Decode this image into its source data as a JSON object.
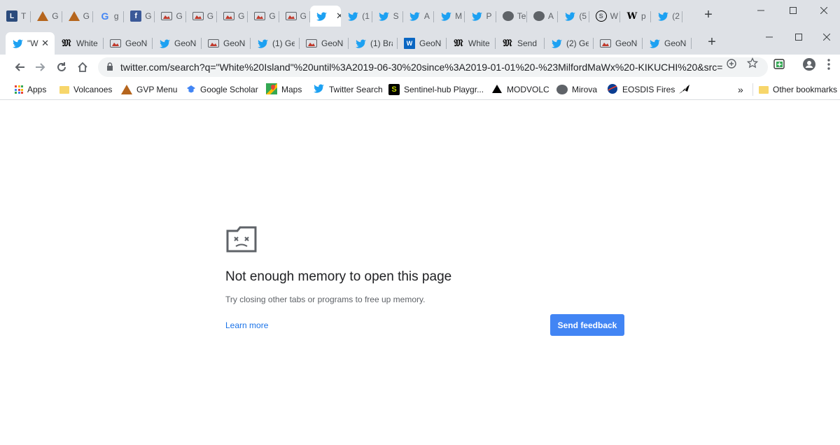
{
  "outer_window": {
    "tabs": [
      {
        "icon": "tweetdeck-icon",
        "label": "T"
      },
      {
        "icon": "volcano-icon",
        "label": "G"
      },
      {
        "icon": "volcano-icon",
        "label": "G"
      },
      {
        "icon": "google-icon",
        "label": "g"
      },
      {
        "icon": "facebook-icon",
        "label": "G"
      },
      {
        "icon": "geonet-icon",
        "label": "G"
      },
      {
        "icon": "geonet-icon",
        "label": "G"
      },
      {
        "icon": "geonet-icon",
        "label": "G"
      },
      {
        "icon": "geonet-icon",
        "label": "G"
      },
      {
        "icon": "geonet-icon",
        "label": "G"
      },
      {
        "icon": "twitter-icon",
        "label": "",
        "active": true
      },
      {
        "icon": "twitter-icon",
        "label": "(1"
      },
      {
        "icon": "twitter-icon",
        "label": "S"
      },
      {
        "icon": "twitter-icon",
        "label": "A"
      },
      {
        "icon": "twitter-icon",
        "label": "M"
      },
      {
        "icon": "twitter-icon",
        "label": "P"
      },
      {
        "icon": "globe-icon",
        "label": "Te"
      },
      {
        "icon": "globe-icon",
        "label": "A"
      },
      {
        "icon": "twitter-icon",
        "label": "(5"
      },
      {
        "icon": "sentinel-icon",
        "label": "W"
      },
      {
        "icon": "wordpress-icon",
        "label": "p"
      },
      {
        "icon": "twitter-icon",
        "label": "(2"
      }
    ],
    "new_tab": "+"
  },
  "inner_window": {
    "tabs": [
      {
        "icon": "twitter-icon",
        "label": "\"W",
        "active": true
      },
      {
        "icon": "nyt-icon",
        "label": "White"
      },
      {
        "icon": "geonet-icon",
        "label": "GeoNe"
      },
      {
        "icon": "twitter-icon",
        "label": "GeoNe"
      },
      {
        "icon": "geonet-icon",
        "label": "GeoNe"
      },
      {
        "icon": "twitter-icon",
        "label": "(1) Ge"
      },
      {
        "icon": "geonet-icon",
        "label": "GeoNe"
      },
      {
        "icon": "twitter-icon",
        "label": "(1) Bra"
      },
      {
        "icon": "w-icon",
        "label": "GeoNe"
      },
      {
        "icon": "nyt-icon",
        "label": "White"
      },
      {
        "icon": "nyt-icon",
        "label": "Send"
      },
      {
        "icon": "twitter-icon",
        "label": "(2) Ge"
      },
      {
        "icon": "geonet-icon",
        "label": "GeoNe"
      },
      {
        "icon": "twitter-icon",
        "label": "GeoNe"
      }
    ],
    "new_tab": "+"
  },
  "toolbar": {
    "url": "twitter.com/search?q=\"White%20Island\"%20until%3A2019-06-30%20since%3A2019-01-01%20-%23MilfordMaWx%20-KIKUCHI%20&src=type..."
  },
  "bookmarks": [
    {
      "label": "Apps",
      "icon": "apps-icon"
    },
    {
      "label": "Volcanoes",
      "icon": "folder-icon"
    },
    {
      "label": "GVP Menu",
      "icon": "volcano-icon"
    },
    {
      "label": "Google Scholar",
      "icon": "scholar-icon"
    },
    {
      "label": "Maps",
      "icon": "maps-icon"
    },
    {
      "label": "Twitter Search",
      "icon": "twitter-icon"
    },
    {
      "label": "Sentinel-hub Playgr...",
      "icon": "sentinel-icon"
    },
    {
      "label": "MODVOLC",
      "icon": "modvolc-icon"
    },
    {
      "label": "Mirova",
      "icon": "globe-icon"
    },
    {
      "label": "EOSDIS Fires",
      "icon": "nasa-icon"
    },
    {
      "label": "",
      "icon": "bird-icon"
    }
  ],
  "bookmarks_overflow": "»",
  "other_bookmarks": "Other bookmarks",
  "error": {
    "title": "Not enough memory to open this page",
    "description": "Try closing other tabs or programs to free up memory.",
    "learn_more": "Learn more",
    "feedback_button": "Send feedback"
  },
  "colors": {
    "tab_strip": "#dee1e6",
    "button_blue": "#4285f4",
    "link_blue": "#1a73e8",
    "twitter_blue": "#1da1f2"
  }
}
